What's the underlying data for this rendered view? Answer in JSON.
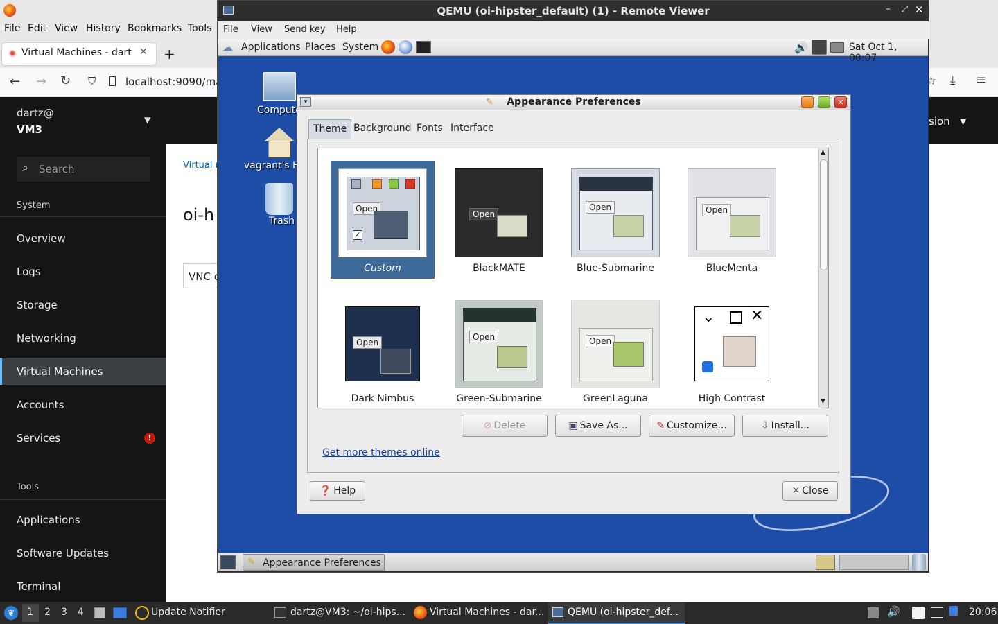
{
  "firefox": {
    "menus": [
      "File",
      "Edit",
      "View",
      "History",
      "Bookmarks",
      "Tools"
    ],
    "tab_title": "Virtual Machines - dartz@",
    "new_tab": "+",
    "url": "localhost:9090/mac"
  },
  "cockpit": {
    "user": "dartz@",
    "host": "VM3",
    "search_placeholder": "Search",
    "section_system": "System",
    "items": [
      "Overview",
      "Logs",
      "Storage",
      "Networking",
      "Virtual Machines",
      "Accounts",
      "Services"
    ],
    "section_tools": "Tools",
    "tools": [
      "Applications",
      "Software Updates",
      "Terminal"
    ],
    "breadcrumb": "Virtual m",
    "heading": "oi-h",
    "vnc": "VNC c",
    "session": "sion",
    "services_badge": "!"
  },
  "qemu": {
    "title": "QEMU (oi-hipster_default) (1) - Remote Viewer",
    "menus": [
      "File",
      "View",
      "Send key",
      "Help"
    ]
  },
  "guest": {
    "panel_menus": [
      "Applications",
      "Places",
      "System"
    ],
    "clock": "Sat Oct  1, 00:07",
    "desktop_icons": [
      "Compute",
      "vagrant's H",
      "Trash"
    ],
    "taskbar_item": "Appearance Preferences"
  },
  "dialog": {
    "title": "Appearance Preferences",
    "tabs": [
      "Theme",
      "Background",
      "Fonts",
      "Interface"
    ],
    "themes": [
      "Custom",
      "BlackMATE",
      "Blue-Submarine",
      "BlueMenta",
      "Dark Nimbus",
      "Green-Submarine",
      "GreenLaguna",
      "High Contrast"
    ],
    "buttons": {
      "delete": "Delete",
      "save_as": "Save As...",
      "customize": "Customize...",
      "install": "Install...",
      "help": "Help",
      "close": "Close"
    },
    "link": "Get more themes online",
    "preview_open": "Open"
  },
  "xfce": {
    "workspaces": [
      "1",
      "2",
      "3",
      "4"
    ],
    "tasks": [
      "Update Notifier",
      "dartz@VM3: ~/oi-hips...",
      "Virtual Machines - dar...",
      "QEMU (oi-hipster_def..."
    ],
    "clock": "20:06"
  },
  "colors": {
    "selected": "#3d6a99",
    "sidebar": "#151515",
    "guest_bg": "#1d4da6"
  }
}
